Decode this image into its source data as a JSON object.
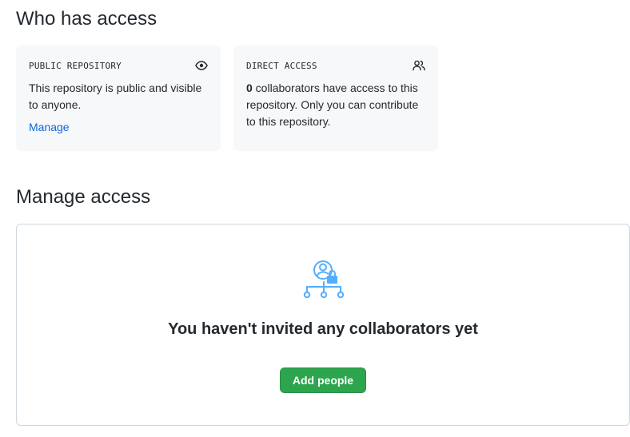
{
  "who_has_access": {
    "title": "Who has access",
    "public_card": {
      "label": "PUBLIC REPOSITORY",
      "icon": "eye-icon",
      "text": "This repository is public and visible to anyone.",
      "link_label": "Manage"
    },
    "direct_card": {
      "label": "DIRECT ACCESS",
      "icon": "people-icon",
      "count": "0",
      "text": " collaborators have access to this repository. Only you can contribute to this repository."
    }
  },
  "manage_access": {
    "title": "Manage access",
    "empty_state": {
      "icon": "collaborators-lock-icon",
      "title": "You haven't invited any collaborators yet",
      "button_label": "Add people"
    }
  },
  "colors": {
    "accent_link": "#0969da",
    "primary_button": "#2da44e",
    "card_bg": "#f6f8fa",
    "illustration": "#54aeff"
  }
}
